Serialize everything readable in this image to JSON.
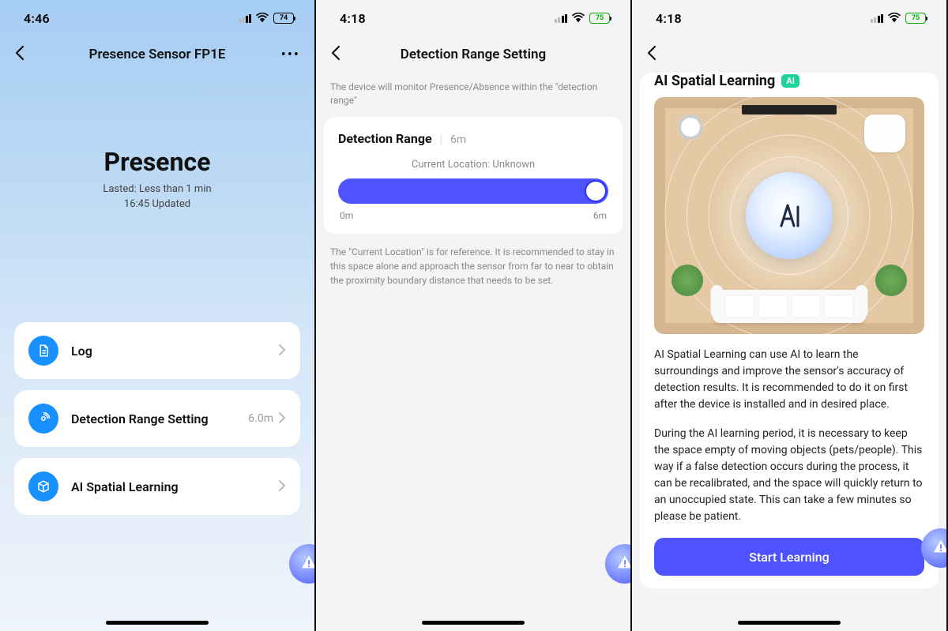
{
  "screen1": {
    "status": {
      "time": "4:46",
      "battery": "74"
    },
    "nav": {
      "title": "Presence Sensor FP1E",
      "more": "•••"
    },
    "hero": {
      "title": "Presence",
      "lasted": "Lasted: Less than 1 min",
      "updated": "16:45 Updated"
    },
    "menu": {
      "log": "Log",
      "detection": "Detection Range Setting",
      "detection_value": "6.0m",
      "ai": "AI Spatial Learning"
    }
  },
  "screen2": {
    "status": {
      "time": "4:18",
      "battery": "75"
    },
    "nav": {
      "title": "Detection Range Setting"
    },
    "intro": "The device will monitor Presence/Absence within the \"detection range\"",
    "card": {
      "label": "Detection Range",
      "value": "6m",
      "current_loc_label": "Current Location: Unknown",
      "min": "0m",
      "max": "6m"
    },
    "note": "The \"Current Location\" is for reference. It is recommended to stay in this space alone and approach the sensor from far to near to obtain the proximity boundary distance that needs to be set."
  },
  "screen3": {
    "status": {
      "time": "4:18",
      "battery": "75"
    },
    "partial_title": "AI Spatial Learning",
    "badge": "AI",
    "desc1": "AI Spatial Learning can use AI to learn the surroundings and improve the sensor's accuracy of detection results. It is recommended to do it on first after the device is installed and in desired place.",
    "desc2": "During the AI learning period, it is necessary to keep the space empty of moving objects (pets/people). This way if a false detection occurs during the process, it can be recalibrated, and the space will quickly return to an unoccupied state. This can take a few minutes so please be patient.",
    "button": "Start Learning"
  }
}
